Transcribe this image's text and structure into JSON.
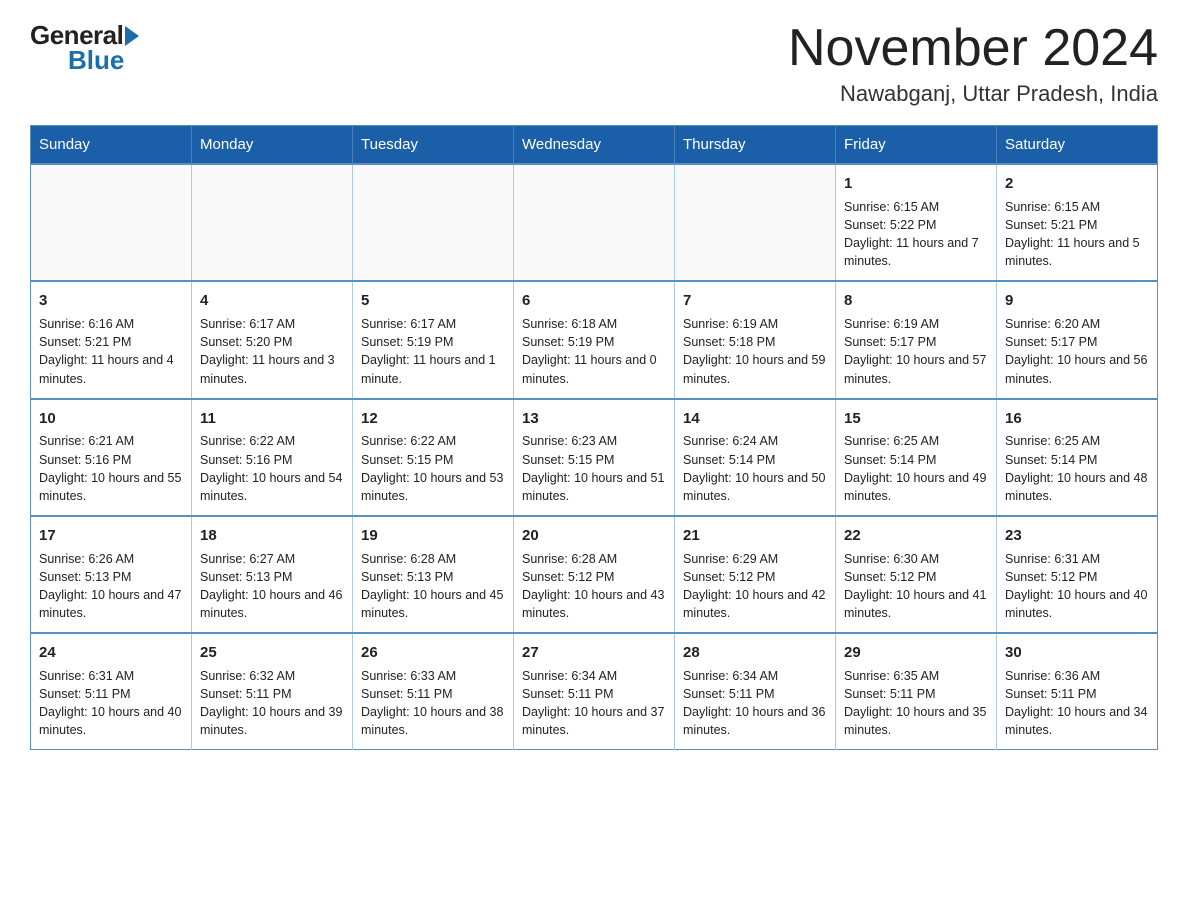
{
  "logo": {
    "part1": "General",
    "part2": "Blue"
  },
  "title": "November 2024",
  "subtitle": "Nawabganj, Uttar Pradesh, India",
  "weekdays": [
    "Sunday",
    "Monday",
    "Tuesday",
    "Wednesday",
    "Thursday",
    "Friday",
    "Saturday"
  ],
  "weeks": [
    [
      {
        "day": "",
        "info": ""
      },
      {
        "day": "",
        "info": ""
      },
      {
        "day": "",
        "info": ""
      },
      {
        "day": "",
        "info": ""
      },
      {
        "day": "",
        "info": ""
      },
      {
        "day": "1",
        "info": "Sunrise: 6:15 AM\nSunset: 5:22 PM\nDaylight: 11 hours and 7 minutes."
      },
      {
        "day": "2",
        "info": "Sunrise: 6:15 AM\nSunset: 5:21 PM\nDaylight: 11 hours and 5 minutes."
      }
    ],
    [
      {
        "day": "3",
        "info": "Sunrise: 6:16 AM\nSunset: 5:21 PM\nDaylight: 11 hours and 4 minutes."
      },
      {
        "day": "4",
        "info": "Sunrise: 6:17 AM\nSunset: 5:20 PM\nDaylight: 11 hours and 3 minutes."
      },
      {
        "day": "5",
        "info": "Sunrise: 6:17 AM\nSunset: 5:19 PM\nDaylight: 11 hours and 1 minute."
      },
      {
        "day": "6",
        "info": "Sunrise: 6:18 AM\nSunset: 5:19 PM\nDaylight: 11 hours and 0 minutes."
      },
      {
        "day": "7",
        "info": "Sunrise: 6:19 AM\nSunset: 5:18 PM\nDaylight: 10 hours and 59 minutes."
      },
      {
        "day": "8",
        "info": "Sunrise: 6:19 AM\nSunset: 5:17 PM\nDaylight: 10 hours and 57 minutes."
      },
      {
        "day": "9",
        "info": "Sunrise: 6:20 AM\nSunset: 5:17 PM\nDaylight: 10 hours and 56 minutes."
      }
    ],
    [
      {
        "day": "10",
        "info": "Sunrise: 6:21 AM\nSunset: 5:16 PM\nDaylight: 10 hours and 55 minutes."
      },
      {
        "day": "11",
        "info": "Sunrise: 6:22 AM\nSunset: 5:16 PM\nDaylight: 10 hours and 54 minutes."
      },
      {
        "day": "12",
        "info": "Sunrise: 6:22 AM\nSunset: 5:15 PM\nDaylight: 10 hours and 53 minutes."
      },
      {
        "day": "13",
        "info": "Sunrise: 6:23 AM\nSunset: 5:15 PM\nDaylight: 10 hours and 51 minutes."
      },
      {
        "day": "14",
        "info": "Sunrise: 6:24 AM\nSunset: 5:14 PM\nDaylight: 10 hours and 50 minutes."
      },
      {
        "day": "15",
        "info": "Sunrise: 6:25 AM\nSunset: 5:14 PM\nDaylight: 10 hours and 49 minutes."
      },
      {
        "day": "16",
        "info": "Sunrise: 6:25 AM\nSunset: 5:14 PM\nDaylight: 10 hours and 48 minutes."
      }
    ],
    [
      {
        "day": "17",
        "info": "Sunrise: 6:26 AM\nSunset: 5:13 PM\nDaylight: 10 hours and 47 minutes."
      },
      {
        "day": "18",
        "info": "Sunrise: 6:27 AM\nSunset: 5:13 PM\nDaylight: 10 hours and 46 minutes."
      },
      {
        "day": "19",
        "info": "Sunrise: 6:28 AM\nSunset: 5:13 PM\nDaylight: 10 hours and 45 minutes."
      },
      {
        "day": "20",
        "info": "Sunrise: 6:28 AM\nSunset: 5:12 PM\nDaylight: 10 hours and 43 minutes."
      },
      {
        "day": "21",
        "info": "Sunrise: 6:29 AM\nSunset: 5:12 PM\nDaylight: 10 hours and 42 minutes."
      },
      {
        "day": "22",
        "info": "Sunrise: 6:30 AM\nSunset: 5:12 PM\nDaylight: 10 hours and 41 minutes."
      },
      {
        "day": "23",
        "info": "Sunrise: 6:31 AM\nSunset: 5:12 PM\nDaylight: 10 hours and 40 minutes."
      }
    ],
    [
      {
        "day": "24",
        "info": "Sunrise: 6:31 AM\nSunset: 5:11 PM\nDaylight: 10 hours and 40 minutes."
      },
      {
        "day": "25",
        "info": "Sunrise: 6:32 AM\nSunset: 5:11 PM\nDaylight: 10 hours and 39 minutes."
      },
      {
        "day": "26",
        "info": "Sunrise: 6:33 AM\nSunset: 5:11 PM\nDaylight: 10 hours and 38 minutes."
      },
      {
        "day": "27",
        "info": "Sunrise: 6:34 AM\nSunset: 5:11 PM\nDaylight: 10 hours and 37 minutes."
      },
      {
        "day": "28",
        "info": "Sunrise: 6:34 AM\nSunset: 5:11 PM\nDaylight: 10 hours and 36 minutes."
      },
      {
        "day": "29",
        "info": "Sunrise: 6:35 AM\nSunset: 5:11 PM\nDaylight: 10 hours and 35 minutes."
      },
      {
        "day": "30",
        "info": "Sunrise: 6:36 AM\nSunset: 5:11 PM\nDaylight: 10 hours and 34 minutes."
      }
    ]
  ]
}
